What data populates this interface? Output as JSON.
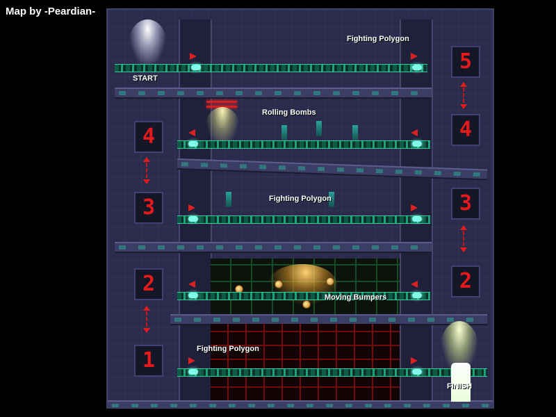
{
  "credit": "Map by -Peardian-",
  "labels": {
    "start": "START",
    "finish": "FINISH",
    "floor5_obstacle": "Fighting Polygon",
    "floor4_obstacle": "Rolling Bombs",
    "floor3_obstacle": "Fighting Polygon",
    "floor2_obstacle": "Moving Bumpers",
    "floor1_obstacle": "Fighting Polygon"
  },
  "elevators": {
    "right_top": {
      "from": "4",
      "to": "5"
    },
    "left_upper": {
      "from": "3",
      "to": "4"
    },
    "right_lower": {
      "from": "2",
      "to": "3"
    },
    "left_lower": {
      "from": "1",
      "to": "2"
    }
  },
  "colors": {
    "elevator_digit": "#e51a1a",
    "track": "#27d3a0",
    "arrow": "#e02020",
    "bumper_maze": "#1d7a3b",
    "polygon_maze": "#9a1010"
  }
}
